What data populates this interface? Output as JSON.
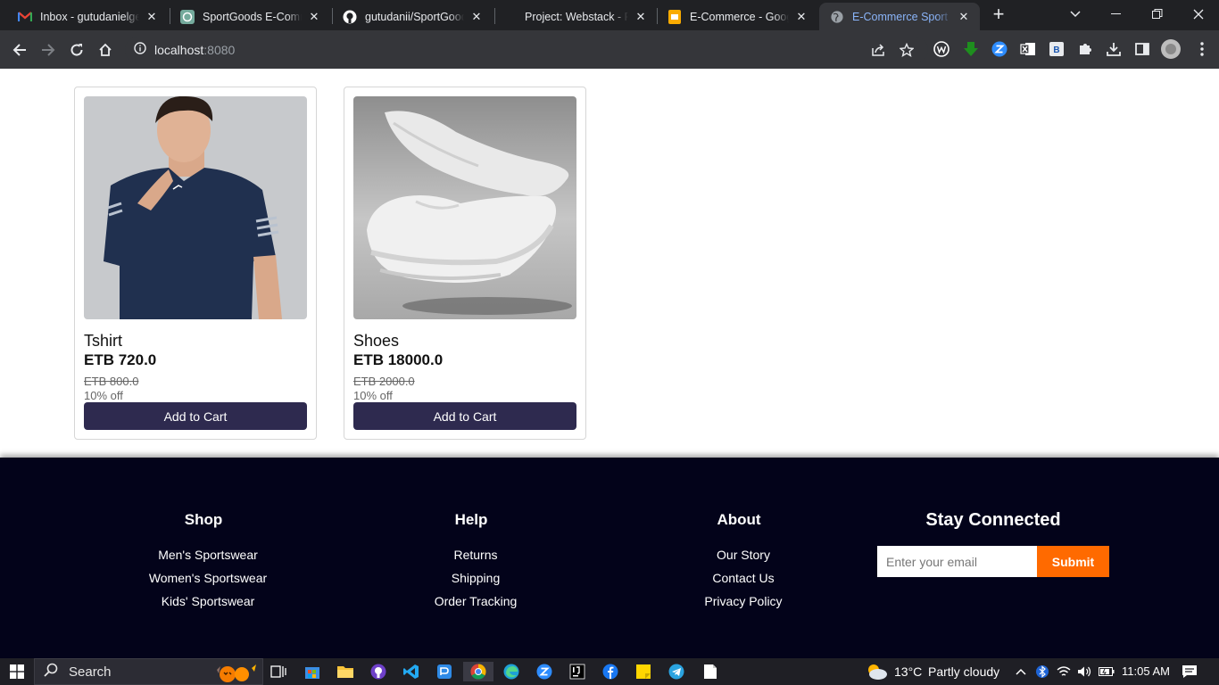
{
  "browser": {
    "tabs": [
      {
        "title": "Inbox - gutudanielgele",
        "icon": "gmail-icon",
        "active": false
      },
      {
        "title": "SportGoods E-Commerce",
        "icon": "chatgpt-icon",
        "active": false
      },
      {
        "title": "gutudanii/SportGoods",
        "icon": "github-icon",
        "active": false
      },
      {
        "title": "Project: Webstack - Po",
        "icon": "none",
        "active": false
      },
      {
        "title": "E-Commerce - Google",
        "icon": "google-slides-icon",
        "active": false
      },
      {
        "title": "E-Commerce Sport We",
        "icon": "globe-icon",
        "active": true
      }
    ],
    "new_tab_label": "+",
    "url_host": "localhost",
    "url_port": ":8080"
  },
  "products": [
    {
      "name": "Tshirt",
      "price": "ETB 720.0",
      "old_price": "ETB 800.0",
      "discount": "10% off",
      "button": "Add to Cart"
    },
    {
      "name": "Shoes",
      "price": "ETB 18000.0",
      "old_price": "ETB 2000.0",
      "discount": "10% off",
      "button": "Add to Cart"
    }
  ],
  "footer": {
    "shop": {
      "title": "Shop",
      "links": [
        "Men's Sportswear",
        "Women's Sportswear",
        "Kids' Sportswear"
      ]
    },
    "help": {
      "title": "Help",
      "links": [
        "Returns",
        "Shipping",
        "Order Tracking"
      ]
    },
    "about": {
      "title": "About",
      "links": [
        "Our Story",
        "Contact Us",
        "Privacy Policy"
      ]
    },
    "stay": {
      "title": "Stay Connected",
      "email_placeholder": "Enter your email",
      "submit_label": "Submit"
    }
  },
  "taskbar": {
    "search_label": "Search",
    "temperature": "13°C",
    "weather": "Partly cloudy",
    "time": "11:05 AM"
  },
  "colors": {
    "button": "#2e2a4f",
    "footer_bg": "#03031a",
    "submit": "#ff6a00"
  }
}
